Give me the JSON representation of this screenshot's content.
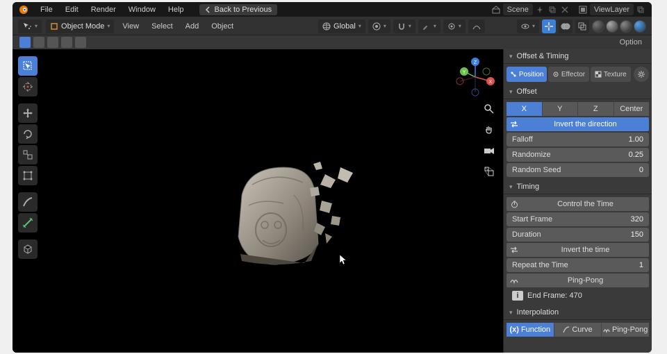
{
  "menubar": {
    "items": [
      "File",
      "Edit",
      "Render",
      "Window",
      "Help"
    ],
    "back": "Back to Previous",
    "scene_label": "Scene",
    "viewlayer_label": "ViewLayer"
  },
  "toolbar2": {
    "mode": "Object Mode",
    "menus": [
      "View",
      "Select",
      "Add",
      "Object"
    ],
    "orientation": "Global"
  },
  "toolbar3": {
    "options": "Option"
  },
  "panel": {
    "header": "Offset & Timing",
    "tabs": {
      "position": "Position",
      "effector": "Effector",
      "texture": "Texture"
    },
    "offset": {
      "header": "Offset",
      "axes": [
        "X",
        "Y",
        "Z",
        "Center"
      ],
      "invert": "Invert the direction",
      "falloff_label": "Falloff",
      "falloff_value": "1.00",
      "randomize_label": "Randomize",
      "randomize_value": "0.25",
      "seed_label": "Random Seed",
      "seed_value": "0"
    },
    "timing": {
      "header": "Timing",
      "control": "Control the Time",
      "start_label": "Start Frame",
      "start_value": "320",
      "duration_label": "Duration",
      "duration_value": "150",
      "invert": "Invert the time",
      "repeat_label": "Repeat the Time",
      "repeat_value": "1",
      "pingpong": "Ping-Pong",
      "endframe": "End Frame: 470"
    },
    "interp": {
      "header": "Interpolation",
      "tabs": {
        "function": "Function",
        "curve": "Curve",
        "pingpong": "Ping-Pong"
      }
    }
  }
}
